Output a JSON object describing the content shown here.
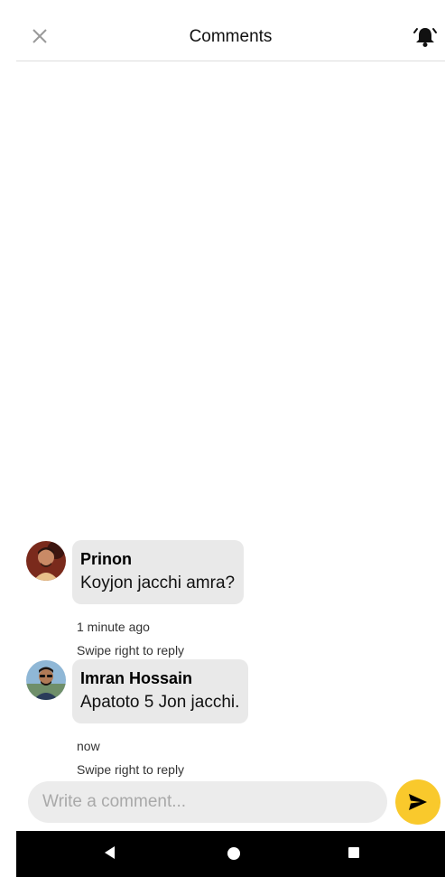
{
  "header": {
    "title": "Comments",
    "close_icon": "close-icon",
    "bell_icon": "notification-ringing-bell-icon"
  },
  "comments": [
    {
      "author": "Prinon",
      "text": "Koyjon jacchi amra?",
      "time": "1 minute ago",
      "reply_hint": "Swipe right to reply",
      "avatar_icon": "user-avatar"
    },
    {
      "author": "Imran Hossain",
      "text": "Apatoto 5 Jon jacchi.",
      "time": "now",
      "reply_hint": "Swipe right to reply",
      "avatar_icon": "user-avatar"
    }
  ],
  "composer": {
    "placeholder": "Write a comment...",
    "value": "",
    "send_icon": "send-icon",
    "send_color": "#f9c92c"
  },
  "navbar": {
    "back_icon": "back-triangle-icon",
    "home_icon": "home-circle-icon",
    "recents_icon": "recents-square-icon"
  }
}
